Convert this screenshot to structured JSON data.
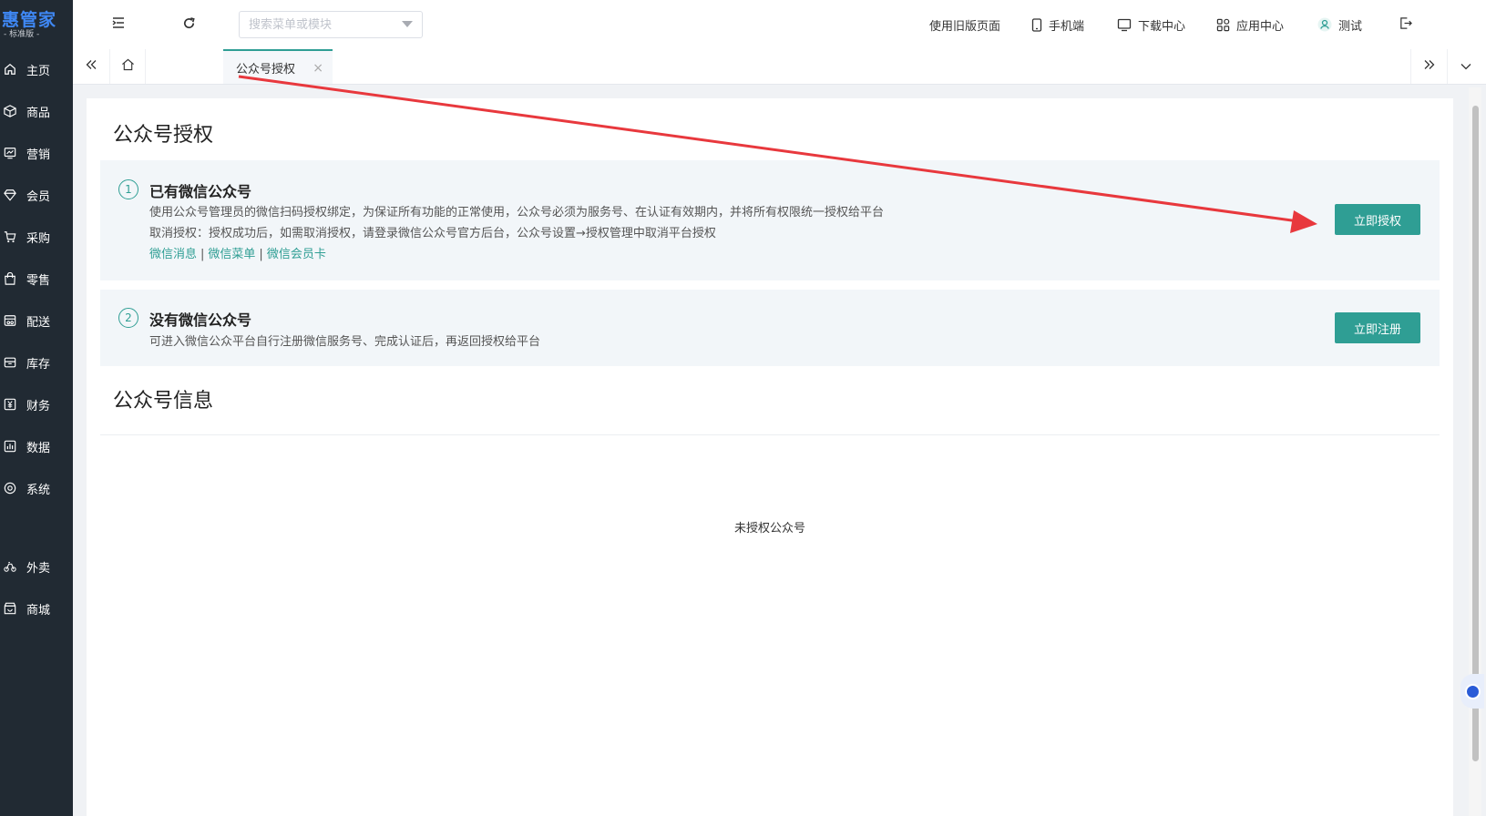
{
  "brand": {
    "name": "惠管家",
    "edition": "- 标准版 -"
  },
  "sidebar": {
    "items": [
      {
        "label": "主页",
        "icon": "home-icon"
      },
      {
        "label": "商品",
        "icon": "box-icon"
      },
      {
        "label": "营销",
        "icon": "marketing-chart-icon"
      },
      {
        "label": "会员",
        "icon": "diamond-icon"
      },
      {
        "label": "采购",
        "icon": "cart-icon"
      },
      {
        "label": "零售",
        "icon": "bag-icon"
      },
      {
        "label": "配送",
        "icon": "delivery-icon"
      },
      {
        "label": "库存",
        "icon": "inventory-icon"
      },
      {
        "label": "财务",
        "icon": "yen-icon"
      },
      {
        "label": "数据",
        "icon": "bar-chart-icon"
      },
      {
        "label": "系统",
        "icon": "settings-icon"
      },
      {
        "label": "外卖",
        "icon": "bike-icon"
      },
      {
        "label": "商城",
        "icon": "store-icon"
      }
    ]
  },
  "header": {
    "search_placeholder": "搜索菜单或模块",
    "old_page": "使用旧版页面",
    "mobile": "手机端",
    "download": "下载中心",
    "apps": "应用中心",
    "user": "测试"
  },
  "tabs": {
    "active_label": "公众号授权",
    "close": "×"
  },
  "page": {
    "title": "公众号授权",
    "option1": {
      "num": "1",
      "title": "已有微信公众号",
      "desc1": "使用公众号管理员的微信扫码授权绑定，为保证所有功能的正常使用，公众号必须为服务号、在认证有效期内，并将所有权限统一授权给平台",
      "desc2": "取消授权：授权成功后，如需取消授权，请登录微信公众号官方后台，公众号设置→授权管理中取消平台授权",
      "links": [
        "微信消息",
        "微信菜单",
        "微信会员卡"
      ],
      "link_sep": "|",
      "button": "立即授权"
    },
    "option2": {
      "num": "2",
      "title": "没有微信公众号",
      "desc": "可进入微信公众平台自行注册微信服务号、完成认证后，再返回授权给平台",
      "button": "立即注册"
    },
    "info_title": "公众号信息",
    "empty_text": "未授权公众号"
  },
  "colors": {
    "accent": "#2f9e94",
    "sidebar_bg": "#212a33",
    "annotation_arrow": "#e8383d"
  }
}
